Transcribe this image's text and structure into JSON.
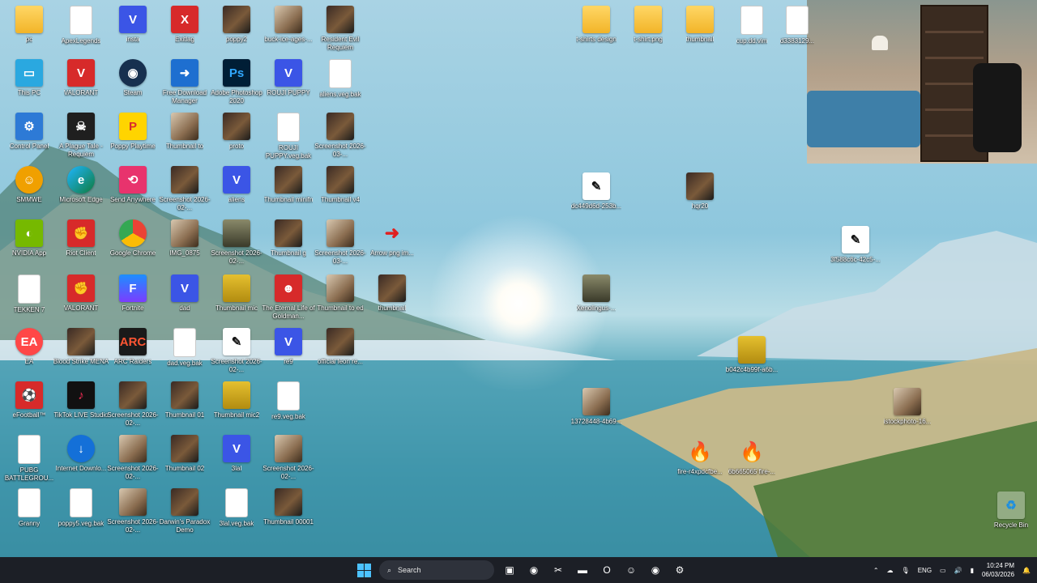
{
  "desktop": {
    "icons": [
      {
        "label": "pc",
        "icon": "folder-icon",
        "style": "folder",
        "glyph": ""
      },
      {
        "label": "ApexLegends",
        "icon": "file-icon",
        "style": "file",
        "glyph": ""
      },
      {
        "label": "insta",
        "icon": "v-app-icon",
        "style": "v",
        "glyph": "V"
      },
      {
        "label": "Exitlag",
        "icon": "exitlag-icon",
        "style": "red",
        "glyph": "X"
      },
      {
        "label": "poppy2",
        "icon": "thumbnail-icon",
        "style": "thumb",
        "glyph": ""
      },
      {
        "label": "buck-ice-ages-...",
        "icon": "image-icon",
        "style": "thumb2",
        "glyph": ""
      },
      {
        "label": "Resident Evil Requiem",
        "icon": "game-icon",
        "style": "thumb",
        "glyph": ""
      },
      {
        "label": "This PC",
        "icon": "monitor-icon",
        "style": "pc",
        "glyph": "▭"
      },
      {
        "label": "VALORANT",
        "icon": "valorant-icon",
        "style": "red",
        "glyph": "V"
      },
      {
        "label": "Steam",
        "icon": "steam-icon",
        "style": "steam",
        "glyph": "◉"
      },
      {
        "label": "Free Download Manager",
        "icon": "download-manager-icon",
        "style": "blue",
        "glyph": "➜"
      },
      {
        "label": "Adobe Photoshop 2020",
        "icon": "photoshop-icon",
        "style": "ps",
        "glyph": "Ps"
      },
      {
        "label": "ROUJI PUPPY",
        "icon": "v-app-icon",
        "style": "v",
        "glyph": "V"
      },
      {
        "label": "aliens.veg.bak",
        "icon": "file-icon",
        "style": "file",
        "glyph": ""
      },
      {
        "label": "Control Panel",
        "icon": "control-panel-icon",
        "style": "ctrl",
        "glyph": "⚙"
      },
      {
        "label": "A Plague Tale - Requiem",
        "icon": "game-icon",
        "style": "dark",
        "glyph": "☠"
      },
      {
        "label": "Poppy Playtime",
        "icon": "poppy-playtime-icon",
        "style": "yellow",
        "glyph": "P"
      },
      {
        "label": "Thumbnail to",
        "icon": "thumbnail-icon",
        "style": "thumb2",
        "glyph": ""
      },
      {
        "label": "proto",
        "icon": "thumbnail-icon",
        "style": "thumb",
        "glyph": ""
      },
      {
        "label": "ROUJI PUPPY.veg.bak",
        "icon": "file-icon",
        "style": "file",
        "glyph": ""
      },
      {
        "label": "Screenshot 2026-03-...",
        "icon": "screenshot-icon",
        "style": "thumb",
        "glyph": ""
      },
      {
        "label": "SMMWE",
        "icon": "smmwe-icon",
        "style": "ssmwe",
        "glyph": "☺"
      },
      {
        "label": "Microsoft Edge",
        "icon": "edge-icon",
        "style": "edge",
        "glyph": "e"
      },
      {
        "label": "Send Anywhere",
        "icon": "send-anywhere-icon",
        "style": "pink",
        "glyph": "⟲"
      },
      {
        "label": "Screenshot 2026-02-...",
        "icon": "screenshot-icon",
        "style": "thumb",
        "glyph": ""
      },
      {
        "label": "aliens",
        "icon": "v-app-icon",
        "style": "v",
        "glyph": "V"
      },
      {
        "label": "Thumbnail minifn",
        "icon": "thumbnail-icon",
        "style": "thumb",
        "glyph": ""
      },
      {
        "label": "Thumbnail v4",
        "icon": "thumbnail-icon",
        "style": "thumb",
        "glyph": ""
      },
      {
        "label": "NVIDIA App",
        "icon": "nvidia-icon",
        "style": "green",
        "glyph": "◐"
      },
      {
        "label": "Riot Client",
        "icon": "riot-icon",
        "style": "red",
        "glyph": "✊"
      },
      {
        "label": "Google Chrome",
        "icon": "chrome-icon",
        "style": "chrome",
        "glyph": ""
      },
      {
        "label": "IMG_0875",
        "icon": "image-icon",
        "style": "thumb2",
        "glyph": ""
      },
      {
        "label": "Screenshot 2026-02-...",
        "icon": "screenshot-icon",
        "style": "person",
        "glyph": ""
      },
      {
        "label": "Thumbnail g",
        "icon": "thumbnail-icon",
        "style": "thumb",
        "glyph": ""
      },
      {
        "label": "Screenshot 2026-03-...",
        "icon": "screenshot-icon",
        "style": "thumb2",
        "glyph": ""
      },
      {
        "label": "Arrow png im...",
        "icon": "arrow-icon",
        "style": "arrow",
        "glyph": "➜"
      },
      {
        "label": "TEKKEN 7",
        "icon": "file-icon",
        "style": "file",
        "glyph": ""
      },
      {
        "label": "VALORANT",
        "icon": "riot-icon",
        "style": "red",
        "glyph": "✊"
      },
      {
        "label": "Fortnite",
        "icon": "fortnite-icon",
        "style": "fortnite",
        "glyph": "F"
      },
      {
        "label": "dad",
        "icon": "v-app-icon",
        "style": "v",
        "glyph": "V"
      },
      {
        "label": "Thumbnail mic",
        "icon": "thumbnail-icon",
        "style": "gold",
        "glyph": ""
      },
      {
        "label": "The Eternal Life of Goldman...",
        "icon": "game-icon",
        "style": "red",
        "glyph": "☻"
      },
      {
        "label": "Thumbnail to ed",
        "icon": "thumbnail-icon",
        "style": "thumb2",
        "glyph": ""
      },
      {
        "label": "thumbnail",
        "icon": "thumbnail-icon",
        "style": "thumb",
        "glyph": ""
      },
      {
        "label": "EA",
        "icon": "ea-icon",
        "style": "ea",
        "glyph": "EA"
      },
      {
        "label": "Blood Strike MENA",
        "icon": "game-icon",
        "style": "thumb",
        "glyph": ""
      },
      {
        "label": "ARC Raiders",
        "icon": "arc-raiders-icon",
        "style": "arc",
        "glyph": "ARC"
      },
      {
        "label": "dad.veg.bak",
        "icon": "file-icon",
        "style": "file",
        "glyph": ""
      },
      {
        "label": "Screenshot 2026-02-...",
        "icon": "screenshot-icon",
        "style": "swirl",
        "glyph": "✎"
      },
      {
        "label": "re9",
        "icon": "v-app-icon",
        "style": "v",
        "glyph": "V"
      },
      {
        "label": "official leon re...",
        "icon": "image-icon",
        "style": "thumb",
        "glyph": ""
      },
      {
        "label": "eFootball™",
        "icon": "efootball-icon",
        "style": "red",
        "glyph": "⚽"
      },
      {
        "label": "TikTok LIVE Studio",
        "icon": "tiktok-icon",
        "style": "tiktok",
        "glyph": "♪"
      },
      {
        "label": "Screenshot 2026-02-...",
        "icon": "screenshot-icon",
        "style": "thumb",
        "glyph": ""
      },
      {
        "label": "Thumbnail 01",
        "icon": "thumbnail-icon",
        "style": "thumb",
        "glyph": ""
      },
      {
        "label": "Thumbnail mic2",
        "icon": "thumbnail-icon",
        "style": "gold",
        "glyph": ""
      },
      {
        "label": "re9.veg.bak",
        "icon": "file-icon",
        "style": "file",
        "glyph": ""
      },
      {
        "label": "PUBG BATTLEGROU...",
        "icon": "file-icon",
        "style": "file",
        "glyph": ""
      },
      {
        "label": "Internet Downlo...",
        "icon": "internet-download-manager-icon",
        "style": "ie",
        "glyph": "↓"
      },
      {
        "label": "Screenshot 2026-02-...",
        "icon": "screenshot-icon",
        "style": "thumb2",
        "glyph": ""
      },
      {
        "label": "Thumbnail 02",
        "icon": "thumbnail-icon",
        "style": "thumb",
        "glyph": ""
      },
      {
        "label": "3lal",
        "icon": "v-app-icon",
        "style": "v",
        "glyph": "V"
      },
      {
        "label": "Screenshot 2026-02-...",
        "icon": "screenshot-icon",
        "style": "thumb2",
        "glyph": ""
      },
      {
        "label": "Granny",
        "icon": "file-icon",
        "style": "file",
        "glyph": ""
      },
      {
        "label": "poppy5.veg.bak",
        "icon": "file-icon",
        "style": "file",
        "glyph": ""
      },
      {
        "label": "Screenshot 2026-02-...",
        "icon": "screenshot-icon",
        "style": "thumb2",
        "glyph": ""
      },
      {
        "label": "Darwin's Paradox Demo",
        "icon": "game-icon",
        "style": "thumb",
        "glyph": ""
      },
      {
        "label": "3lal.veg.bak",
        "icon": "file-icon",
        "style": "file",
        "glyph": ""
      },
      {
        "label": "Thumbnail 00001",
        "icon": "thumbnail-icon",
        "style": "thumb",
        "glyph": ""
      },
      {
        "label": "t-shirts design",
        "icon": "folder-icon",
        "style": "folder",
        "glyph": ""
      },
      {
        "label": "t-shirt.png",
        "icon": "folder-icon",
        "style": "folder",
        "glyph": ""
      },
      {
        "label": "thumbnail",
        "icon": "folder-icon",
        "style": "folder",
        "glyph": ""
      },
      {
        "label": "cup.dd.vim",
        "icon": "file-icon",
        "style": "file",
        "glyph": ""
      },
      {
        "label": "d3383129...",
        "icon": "file-icon",
        "style": "file",
        "glyph": ""
      },
      {
        "label": "dc449d6d-253b...",
        "icon": "image-icon",
        "style": "swirl",
        "glyph": "✎"
      },
      {
        "label": "hqr20",
        "icon": "image-icon",
        "style": "thumb",
        "glyph": ""
      },
      {
        "label": "Xenolingus-...",
        "icon": "image-icon",
        "style": "person",
        "glyph": ""
      },
      {
        "label": "13728448-4b69...",
        "icon": "image-icon",
        "style": "thumb2",
        "glyph": ""
      },
      {
        "label": "b042c4b99f-a6b...",
        "icon": "image-icon",
        "style": "gold",
        "glyph": ""
      },
      {
        "label": "fire-r4xpdcfbe...",
        "icon": "fire-icon",
        "style": "fire",
        "glyph": "🔥"
      },
      {
        "label": "6b665065 fire-...",
        "icon": "fire-icon",
        "style": "fire",
        "glyph": "🔥"
      },
      {
        "label": "3f588c6c-42c5-...",
        "icon": "image-icon",
        "style": "swirl",
        "glyph": "✎"
      },
      {
        "label": "istockphoto-16...",
        "icon": "image-icon",
        "style": "thumb2",
        "glyph": ""
      },
      {
        "label": "Recycle Bin",
        "icon": "recycle-bin-icon",
        "style": "recycle",
        "glyph": "♻"
      }
    ]
  },
  "taskbar": {
    "search_placeholder": "Search",
    "apps": [
      {
        "name": "task-view-icon",
        "glyph": "▣"
      },
      {
        "name": "chrome-taskbar-icon",
        "glyph": "◉"
      },
      {
        "name": "snipping-tool-icon",
        "glyph": "✂"
      },
      {
        "name": "file-explorer-icon",
        "glyph": "▬"
      },
      {
        "name": "opera-icon",
        "glyph": "O"
      },
      {
        "name": "discord-icon",
        "glyph": "☺"
      },
      {
        "name": "steam-taskbar-icon",
        "glyph": "◉"
      },
      {
        "name": "settings-taskbar-icon",
        "glyph": "⚙"
      }
    ],
    "tray": {
      "language": "ENG",
      "time": "10:24 PM",
      "date": "06/03/2026"
    }
  }
}
